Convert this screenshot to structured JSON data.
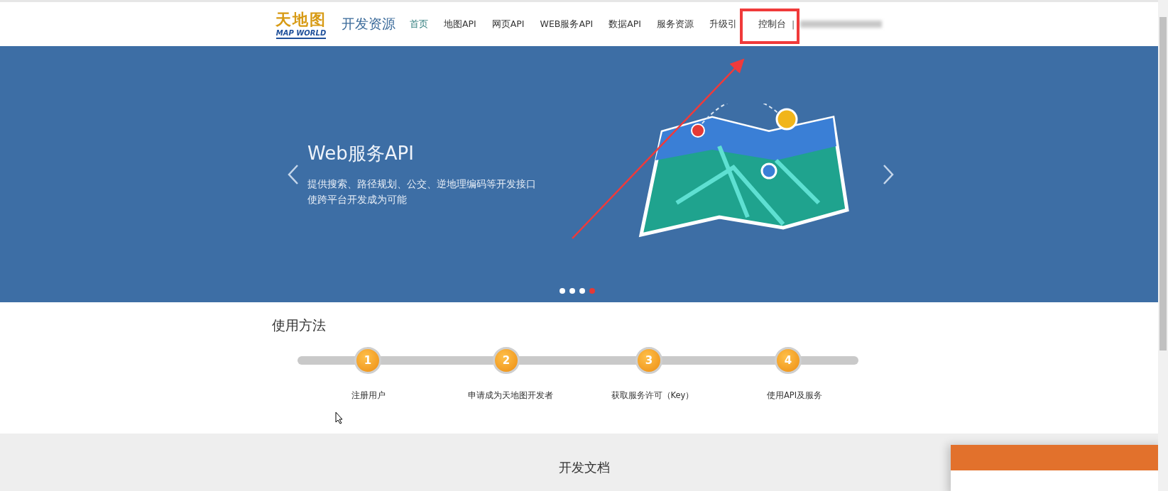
{
  "header": {
    "logo_top": "天地图",
    "logo_bottom": "MAP WORLD",
    "site_title": "开发资源",
    "nav": [
      {
        "label": "首页",
        "selected": true
      },
      {
        "label": "地图API",
        "selected": false
      },
      {
        "label": "网页API",
        "selected": false
      },
      {
        "label": "WEB服务API",
        "selected": false
      },
      {
        "label": "数据API",
        "selected": false
      },
      {
        "label": "服务资源",
        "selected": false
      },
      {
        "label": "升级引",
        "selected": false
      }
    ],
    "console_link": "控制台",
    "separator": "|"
  },
  "banner": {
    "title": "Web服务API",
    "lines": [
      "提供搜索、路径规划、公交、逆地理编码等开发接口",
      "使跨平台开发成为可能"
    ],
    "dots": [
      {
        "selected": false
      },
      {
        "selected": false
      },
      {
        "selected": false
      },
      {
        "selected": true
      }
    ]
  },
  "usage": {
    "title": "使用方法",
    "steps": [
      {
        "number": "1",
        "label": "注册用户"
      },
      {
        "number": "2",
        "label": "申请成为天地图开发者"
      },
      {
        "number": "3",
        "label": "获取服务许可（Key）"
      },
      {
        "number": "4",
        "label": "使用API及服务"
      }
    ]
  },
  "docs": {
    "title": "开发文档"
  }
}
